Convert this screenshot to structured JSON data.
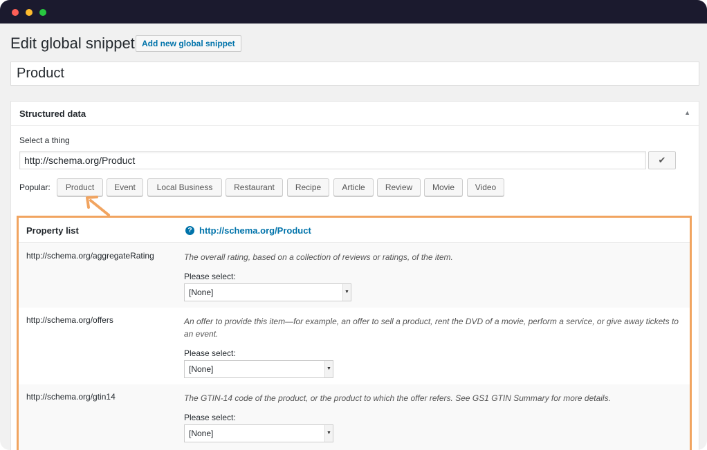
{
  "header": {
    "title": "Edit global snippet",
    "add_button_label": "Add new global snippet"
  },
  "snippet_title": "Product",
  "structured_data": {
    "panel_title": "Structured data",
    "toggle_icon": "▲",
    "select_label": "Select a thing",
    "url_value": "http://schema.org/Product",
    "confirm_icon": "✔",
    "popular_label": "Popular:",
    "popular_items": [
      "Product",
      "Event",
      "Local Business",
      "Restaurant",
      "Recipe",
      "Article",
      "Review",
      "Movie",
      "Video"
    ]
  },
  "property_list": {
    "header_label": "Property list",
    "help_icon": "?",
    "type_link": "http://schema.org/Product",
    "rows": [
      {
        "name": "http://schema.org/aggregateRating",
        "description": "The overall rating, based on a collection of reviews or ratings, of the item.",
        "please_select": "Please select:",
        "selected": "[None]"
      },
      {
        "name": "http://schema.org/offers",
        "description": "An offer to provide this item—for example, an offer to sell a product, rent the DVD of a movie, perform a service, or give away tickets to an event.",
        "please_select": "Please select:",
        "selected": "[None]"
      },
      {
        "name": "http://schema.org/gtin14",
        "description": "The GTIN-14 code of the product, or the product to which the offer refers. See GS1 GTIN Summary for more details.",
        "please_select": "Please select:",
        "selected": "[None]"
      }
    ]
  },
  "colors": {
    "highlight": "#f1a460",
    "link": "#0073aa",
    "titlebar": "#1b1a2e"
  }
}
